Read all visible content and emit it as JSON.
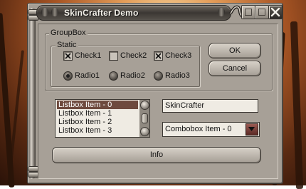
{
  "window": {
    "title": "SkinCrafter Demo"
  },
  "groupbox": {
    "label": "GroupBox"
  },
  "static_group": {
    "label": "Static"
  },
  "checks": [
    {
      "label": "Check1",
      "checked": true
    },
    {
      "label": "Check2",
      "checked": false
    },
    {
      "label": "Check3",
      "checked": true
    }
  ],
  "radios": [
    {
      "label": "Radio1",
      "selected": true
    },
    {
      "label": "Radio2",
      "selected": false
    },
    {
      "label": "Radio3",
      "selected": false
    }
  ],
  "buttons": {
    "ok": "OK",
    "cancel": "Cancel",
    "info": "Info"
  },
  "listbox": {
    "items": [
      "Listbox Item - 0",
      "Listbox Item - 1",
      "Listbox Item - 2",
      "Listbox Item - 3"
    ],
    "selected_index": 0
  },
  "edit": {
    "value": "SkinCrafter"
  },
  "combobox": {
    "value": "Combobox Item - 0"
  },
  "colors": {
    "selection": "#6e4a3e",
    "face": "#a7a097",
    "titlebar": "#3b3733"
  },
  "icons": [
    "minimize-icon",
    "maximize-icon",
    "close-icon",
    "scroll-up-icon",
    "scroll-down-icon",
    "dropdown-arrow-icon"
  ]
}
